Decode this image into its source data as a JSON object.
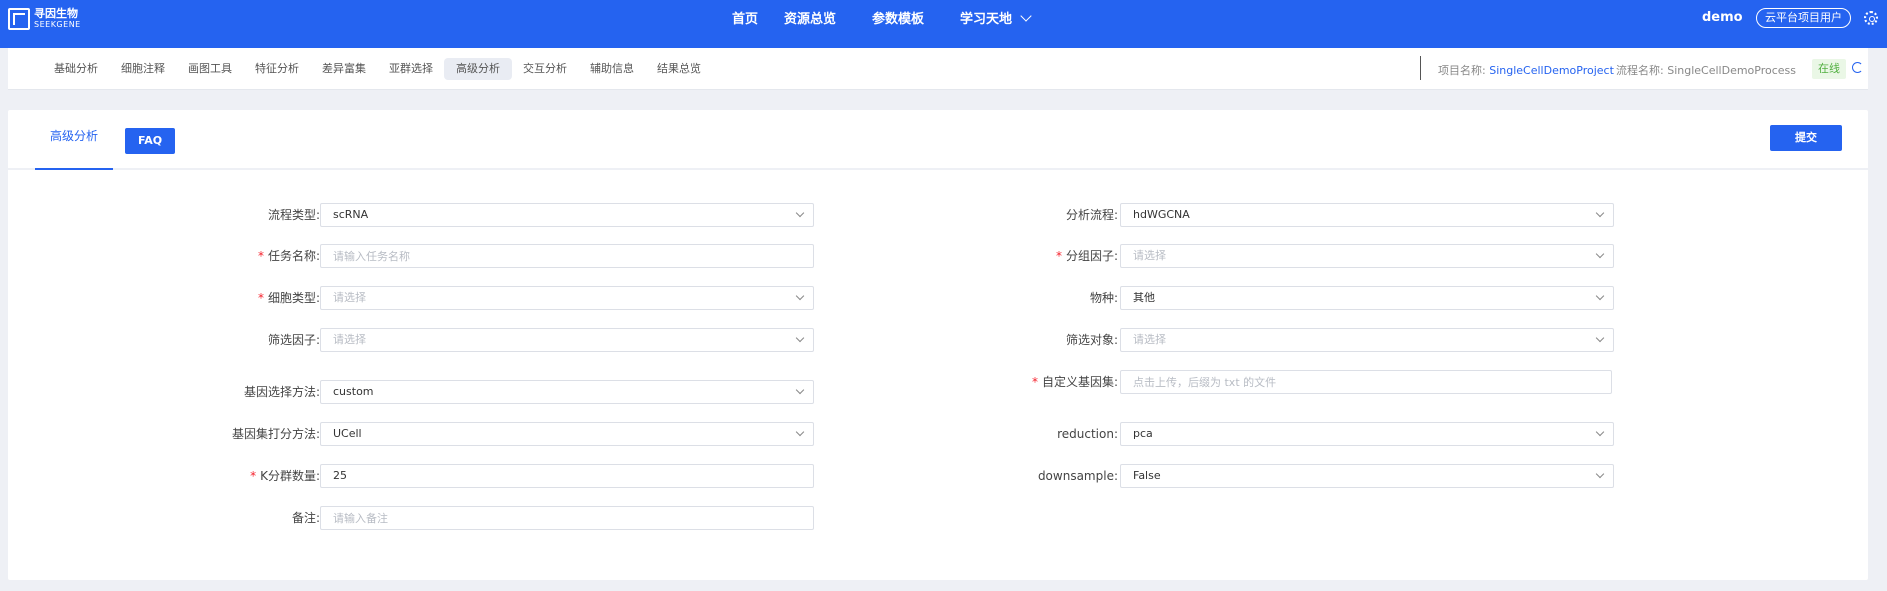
{
  "brand": {
    "name_cn": "寻因生物",
    "name_en": "SEEKGENE"
  },
  "top_nav": {
    "home": "首页",
    "resources": "资源总览",
    "templates": "参数模板",
    "learning": "学习天地"
  },
  "user": {
    "name": "demo",
    "role": "云平台项目用户"
  },
  "sub_tabs": [
    "基础分析",
    "细胞注释",
    "画图工具",
    "特征分析",
    "差异富集",
    "亚群选择",
    "高级分析",
    "交互分析",
    "辅助信息",
    "结果总览"
  ],
  "project": {
    "label": "项目名称:",
    "value": "SingleCellDemoProject",
    "process_label": "流程名称:",
    "process_value": "SingleCellDemoProcess",
    "status": "在线"
  },
  "panel": {
    "tab": "高级分析",
    "faq": "FAQ",
    "submit": "提交"
  },
  "form": {
    "pipeline_type": {
      "label": "流程类型:",
      "value": "scRNA"
    },
    "analysis_flow": {
      "label": "分析流程:",
      "value": "hdWGCNA"
    },
    "task_name": {
      "label": "任务名称:",
      "placeholder": "请输入任务名称"
    },
    "group_factor": {
      "label": "分组因子:",
      "placeholder": "请选择"
    },
    "cell_type": {
      "label": "细胞类型:",
      "placeholder": "请选择"
    },
    "species": {
      "label": "物种:",
      "value": "其他"
    },
    "filter_factor": {
      "label": "筛选因子:",
      "placeholder": "请选择"
    },
    "filter_object": {
      "label": "筛选对象:",
      "placeholder": "请选择"
    },
    "gene_select_method": {
      "label": "基因选择方法:",
      "value": "custom"
    },
    "custom_gene_set": {
      "label": "自定义基因集:",
      "placeholder": "点击上传，后缀为 txt 的文件"
    },
    "gene_score_method": {
      "label": "基因集打分方法:",
      "value": "UCell"
    },
    "reduction": {
      "label": "reduction:",
      "value": "pca"
    },
    "k_clusters": {
      "label": "K分群数量:",
      "value": "25"
    },
    "downsample": {
      "label": "downsample:",
      "value": "False"
    },
    "remark": {
      "label": "备注:",
      "placeholder": "请输入备注"
    }
  }
}
